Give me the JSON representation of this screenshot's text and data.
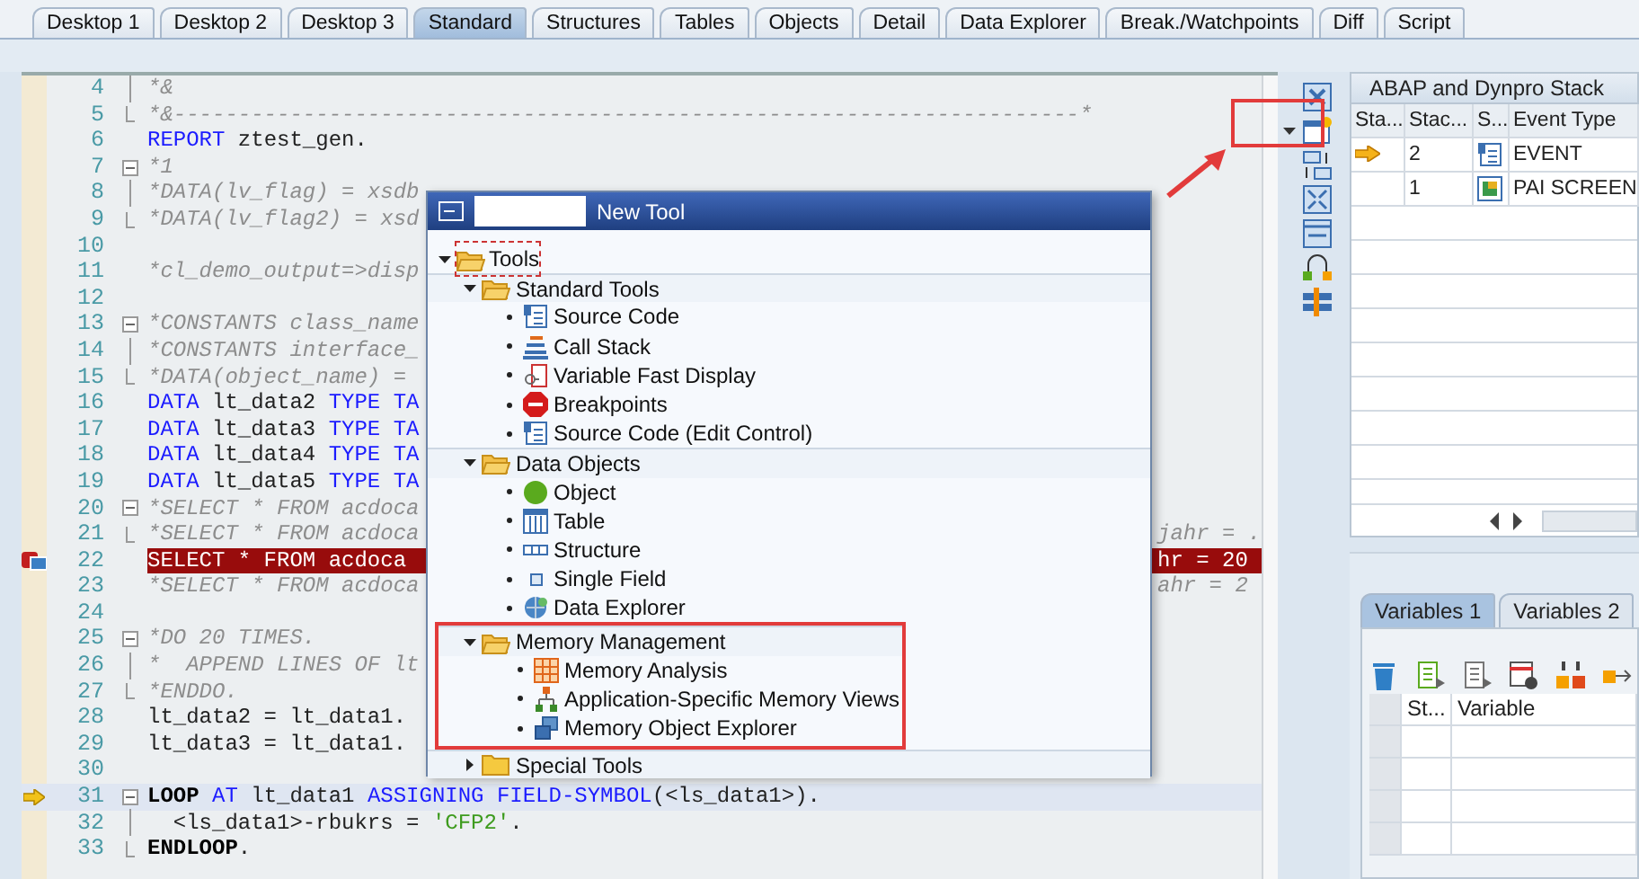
{
  "tabs": [
    {
      "label": "Desktop 1",
      "selected": false
    },
    {
      "label": "Desktop 2",
      "selected": false
    },
    {
      "label": "Desktop 3",
      "selected": false
    },
    {
      "label": "Standard",
      "selected": true
    },
    {
      "label": "Structures",
      "selected": false
    },
    {
      "label": "Tables",
      "selected": false
    },
    {
      "label": "Objects",
      "selected": false
    },
    {
      "label": "Detail",
      "selected": false
    },
    {
      "label": "Data Explorer",
      "selected": false
    },
    {
      "label": "Break./Watchpoints",
      "selected": false
    },
    {
      "label": "Diff",
      "selected": false
    },
    {
      "label": "Script",
      "selected": false
    }
  ],
  "editor": {
    "lines": [
      {
        "children": [
          {
            "number": "4",
            "tokens": [
              {
                "text": "*&",
                "kind": "comment"
              }
            ]
          },
          {
            "number": "5",
            "tokens": [
              {
                "text": "*&----------------------------------------------------------------------*",
                "kind": "comment"
              }
            ]
          }
        ]
      },
      {
        "number": "6",
        "tokens": [
          {
            "text": "REPORT",
            "kind": "keyword"
          },
          {
            "text": " ztest_gen.",
            "kind": "plain"
          }
        ]
      },
      {
        "number": "7",
        "tokens": [
          {
            "text": "*1",
            "kind": "comment"
          }
        ],
        "children": [
          {
            "number": "8",
            "tokens": [
              {
                "text": "*DATA(lv_flag) = xsdb",
                "kind": "comment"
              }
            ]
          },
          {
            "number": "9",
            "tokens": [
              {
                "text": "*DATA(lv_flag2) = xsd",
                "kind": "comment"
              }
            ]
          }
        ]
      },
      {
        "number": "10"
      },
      {
        "number": "11",
        "tokens": [
          {
            "text": "*cl_demo_output=>disp",
            "kind": "comment"
          }
        ]
      },
      {
        "number": "12"
      },
      {
        "number": "13",
        "tokens": [
          {
            "text": "*CONSTANTS class_name",
            "kind": "comment"
          }
        ],
        "children": [
          {
            "number": "14",
            "tokens": [
              {
                "text": "*CONSTANTS interface_",
                "kind": "comment"
              }
            ]
          },
          {
            "number": "15",
            "tokens": [
              {
                "text": "*DATA(object_name) =",
                "kind": "comment"
              }
            ]
          }
        ]
      },
      {
        "number": "16",
        "tokens": [
          {
            "text": "DATA",
            "kind": "keyword"
          },
          {
            "text": " lt_data2 ",
            "kind": "plain"
          },
          {
            "text": "TYPE TA",
            "kind": "keyword"
          }
        ]
      },
      {
        "number": "17",
        "tokens": [
          {
            "text": "DATA",
            "kind": "keyword"
          },
          {
            "text": " lt_data3 ",
            "kind": "plain"
          },
          {
            "text": "TYPE TA",
            "kind": "keyword"
          }
        ]
      },
      {
        "number": "18",
        "tokens": [
          {
            "text": "DATA",
            "kind": "keyword"
          },
          {
            "text": " lt_data4 ",
            "kind": "plain"
          },
          {
            "text": "TYPE TA",
            "kind": "keyword"
          }
        ]
      },
      {
        "number": "19",
        "tokens": [
          {
            "text": "DATA",
            "kind": "keyword"
          },
          {
            "text": " lt_data5 ",
            "kind": "plain"
          },
          {
            "text": "TYPE TA",
            "kind": "keyword"
          }
        ]
      },
      {
        "number": "20",
        "tokens": [
          {
            "text": "*SELECT * FROM acdoca",
            "kind": "comment"
          }
        ],
        "children": [
          {
            "number": "21",
            "tokens": [
              {
                "text": "*SELECT * FROM acdoca",
                "kind": "comment"
              }
            ],
            "right": [
              {
                "text": "jahr = .",
                "kind": "comment"
              }
            ]
          }
        ]
      },
      {
        "number": "22",
        "breakpoint": true,
        "tokens": [
          {
            "text": "SELECT * FROM acdoca",
            "kind": "plain"
          }
        ],
        "right": [
          {
            "text": "hr = 20",
            "kind": "plain"
          }
        ]
      },
      {
        "number": "23",
        "tokens": [
          {
            "text": "*SELECT * FROM acdoca",
            "kind": "comment"
          }
        ],
        "right": [
          {
            "text": "ahr = 2",
            "kind": "comment"
          }
        ]
      },
      {
        "number": "24"
      },
      {
        "number": "25",
        "tokens": [
          {
            "text": "*DO 20 TIMES.",
            "kind": "comment"
          }
        ],
        "children": [
          {
            "number": "26",
            "tokens": [
              {
                "text": "*  APPEND LINES OF lt",
                "kind": "comment"
              }
            ]
          },
          {
            "number": "27",
            "tokens": [
              {
                "text": "*ENDDO.",
                "kind": "comment"
              }
            ]
          }
        ]
      },
      {
        "number": "28",
        "tokens": [
          {
            "text": "lt_data2 = lt_data1.",
            "kind": "plain"
          }
        ]
      },
      {
        "number": "29",
        "tokens": [
          {
            "text": "lt_data3 = lt_data1.",
            "kind": "plain"
          }
        ]
      },
      {
        "number": "30"
      },
      {
        "number": "31",
        "current": true,
        "tokens": [
          {
            "text": "LOOP",
            "kind": "bold"
          },
          {
            "text": " AT",
            "kind": "keyword"
          },
          {
            "text": " lt_data1 ",
            "kind": "plain"
          },
          {
            "text": "ASSIGNING FIELD-SYMBOL",
            "kind": "keyword"
          },
          {
            "text": "(<ls_data1>).",
            "kind": "plain"
          }
        ],
        "children": [
          {
            "number": "32",
            "tokens": [
              {
                "text": "  <ls_data1>-rbukrs = ",
                "kind": "plain"
              },
              {
                "text": "'CFP2'",
                "kind": "string"
              },
              {
                "text": ".",
                "kind": "plain"
              }
            ]
          },
          {
            "number": "33",
            "tokens": [
              {
                "text": "ENDLOOP",
                "kind": "bold"
              },
              {
                "text": ".",
                "kind": "plain"
              }
            ]
          }
        ]
      }
    ]
  },
  "popup": {
    "title": "New Tool",
    "tree": [
      {
        "label": "Tools",
        "expanded": true,
        "selected": true,
        "children": [
          {
            "label": "Standard Tools",
            "expanded": true,
            "selected": false,
            "highlighted": false,
            "children": [
              {
                "label": "Source Code",
                "kind": "source"
              },
              {
                "label": "Call Stack",
                "kind": "stack"
              },
              {
                "label": "Variable Fast Display",
                "kind": "variable"
              },
              {
                "label": "Breakpoints",
                "kind": "stop"
              },
              {
                "label": "Source Code (Edit Control)",
                "kind": "source"
              }
            ]
          },
          {
            "label": "Data Objects",
            "expanded": true,
            "selected": false,
            "highlighted": false,
            "children": [
              {
                "label": "Object",
                "kind": "object"
              },
              {
                "label": "Table",
                "kind": "table"
              },
              {
                "label": "Structure",
                "kind": "structure"
              },
              {
                "label": "Single Field",
                "kind": "field"
              },
              {
                "label": "Data Explorer",
                "kind": "explorer"
              }
            ]
          },
          {
            "label": "Memory Management",
            "expanded": true,
            "selected": false,
            "highlighted": true,
            "children": [
              {
                "label": "Memory Analysis",
                "kind": "memory"
              },
              {
                "label": "Application-Specific Memory Views",
                "kind": "hierarchy"
              },
              {
                "label": "Memory Object Explorer",
                "kind": "cubes"
              }
            ]
          },
          {
            "label": "Special Tools",
            "expanded": false,
            "selected": false,
            "highlighted": false
          }
        ]
      }
    ]
  },
  "stack": {
    "title": "ABAP and Dynpro Stack",
    "columns": [
      "Sta...",
      "Stac...",
      "S...",
      "Event Type"
    ],
    "rows": [
      {
        "current": true,
        "stack_number": "2",
        "kind": "event",
        "event": "EVENT"
      },
      {
        "current": false,
        "stack_number": "1",
        "kind": "screen",
        "event": "PAI SCREEN"
      }
    ]
  },
  "variables": {
    "tabs": [
      {
        "label": "Variables 1",
        "selected": true
      },
      {
        "label": "Variables 2",
        "selected": false
      }
    ],
    "columns": [
      "St...",
      "Variable"
    ]
  }
}
